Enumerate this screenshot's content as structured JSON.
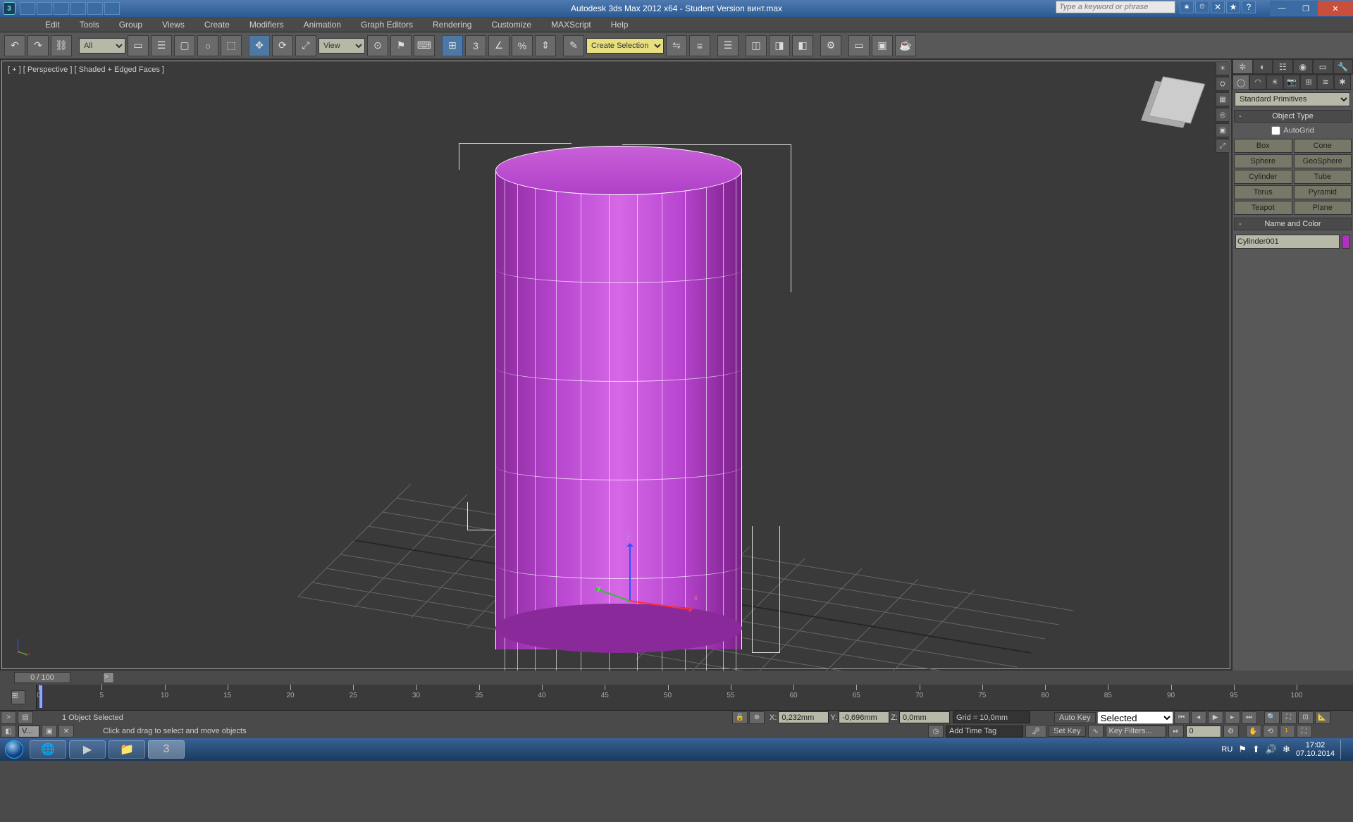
{
  "titlebar": {
    "app_icon": "3",
    "title": "Autodesk 3ds Max 2012 x64  - Student Version   винт.max",
    "search_placeholder": "Type a keyword or phrase"
  },
  "menubar": [
    "Edit",
    "Tools",
    "Group",
    "Views",
    "Create",
    "Modifiers",
    "Animation",
    "Graph Editors",
    "Rendering",
    "Customize",
    "MAXScript",
    "Help"
  ],
  "toolbar": {
    "all_label": "All",
    "view_label": "View",
    "snap_label": "3",
    "selection_label": "Create Selection Se"
  },
  "viewport": {
    "label": "[ + ] [ Perspective ] [ Shaded + Edged Faces ]",
    "axis": {
      "x": "x",
      "y": "y",
      "z": "z"
    }
  },
  "cmdpanel": {
    "dropdown": "Standard Primitives",
    "object_type": "Object Type",
    "autogrid": "AutoGrid",
    "primitives": [
      "Box",
      "Cone",
      "Sphere",
      "GeoSphere",
      "Cylinder",
      "Tube",
      "Torus",
      "Pyramid",
      "Teapot",
      "Plane"
    ],
    "name_and_color": "Name and Color",
    "object_name": "Cylinder001"
  },
  "time": {
    "counter": "0 / 100",
    "ticks": [
      0,
      5,
      10,
      15,
      20,
      25,
      30,
      35,
      40,
      45,
      50,
      55,
      60,
      65,
      70,
      75,
      80,
      85,
      90,
      95,
      100
    ]
  },
  "status": {
    "selection": "1 Object Selected",
    "prompt": "Click and drag to select and move objects",
    "x_label": "X:",
    "x_val": "0,232mm",
    "y_label": "Y:",
    "y_val": "-0,696mm",
    "z_label": "Z:",
    "z_val": "0,0mm",
    "grid": "Grid = 10,0mm",
    "add_time_tag": "Add Time Tag",
    "auto_key": "Auto Key",
    "set_key": "Set Key",
    "selected": "Selected",
    "key_filters": "Key Filters...",
    "frame_field": "0"
  },
  "taskbar": {
    "lang": "RU",
    "time": "17:02",
    "date": "07.10.2014"
  }
}
